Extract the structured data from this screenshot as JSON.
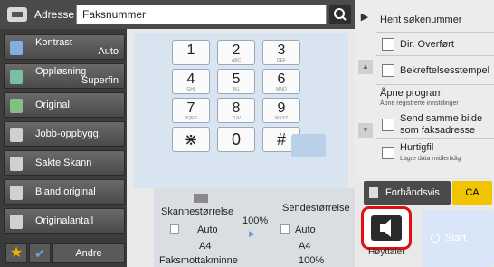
{
  "topbar": {
    "addr_label": "Adresse",
    "addr_value": "Faksnummer"
  },
  "left_buttons": [
    {
      "label": "Kontrast",
      "value": "Auto"
    },
    {
      "label": "Oppløsning",
      "value": "Superfin"
    },
    {
      "label": "Original",
      "value": ""
    },
    {
      "label": "Jobb-oppbygg.",
      "value": ""
    },
    {
      "label": "Sakte Skann",
      "value": ""
    },
    {
      "label": "Bland.original",
      "value": ""
    },
    {
      "label": "Originalantall",
      "value": ""
    }
  ],
  "bottom": {
    "andre": "Andre"
  },
  "keypad": [
    {
      "n": "1",
      "s": ""
    },
    {
      "n": "2",
      "s": "ABC"
    },
    {
      "n": "3",
      "s": "DEF"
    },
    {
      "n": "4",
      "s": "GHI"
    },
    {
      "n": "5",
      "s": "JKL"
    },
    {
      "n": "6",
      "s": "MNO"
    },
    {
      "n": "7",
      "s": "PQRS"
    },
    {
      "n": "8",
      "s": "TUV"
    },
    {
      "n": "9",
      "s": "WXYZ"
    },
    {
      "n": "⋇",
      "s": ""
    },
    {
      "n": "0",
      "s": ""
    },
    {
      "n": "#",
      "s": ""
    }
  ],
  "info": {
    "scan_label": "Skannestørrelse",
    "send_label": "Sendestørrelse",
    "scan_value": "Auto",
    "send_value": "Auto",
    "ratio": "100%",
    "scan_size": "A4",
    "send_size": "A4",
    "fax_label": "Faksmottakminne",
    "fax_value": "100%"
  },
  "right": {
    "fetch": "Hent søkenummer",
    "direct": "Dir. Overført",
    "confirm": "Bekreftelsesstempel",
    "open_prog": "Åpne program",
    "open_prog_sub": "Åpne registrerte innstillinger",
    "same_image": "Send samme bilde som faksadresse",
    "quick": "Hurtigfil",
    "quick_sub": "Lagre data midlertidig"
  },
  "actions": {
    "preview": "Forhåndsvis",
    "ca": "CA",
    "speaker": "Høyttaler",
    "start": "Start"
  }
}
